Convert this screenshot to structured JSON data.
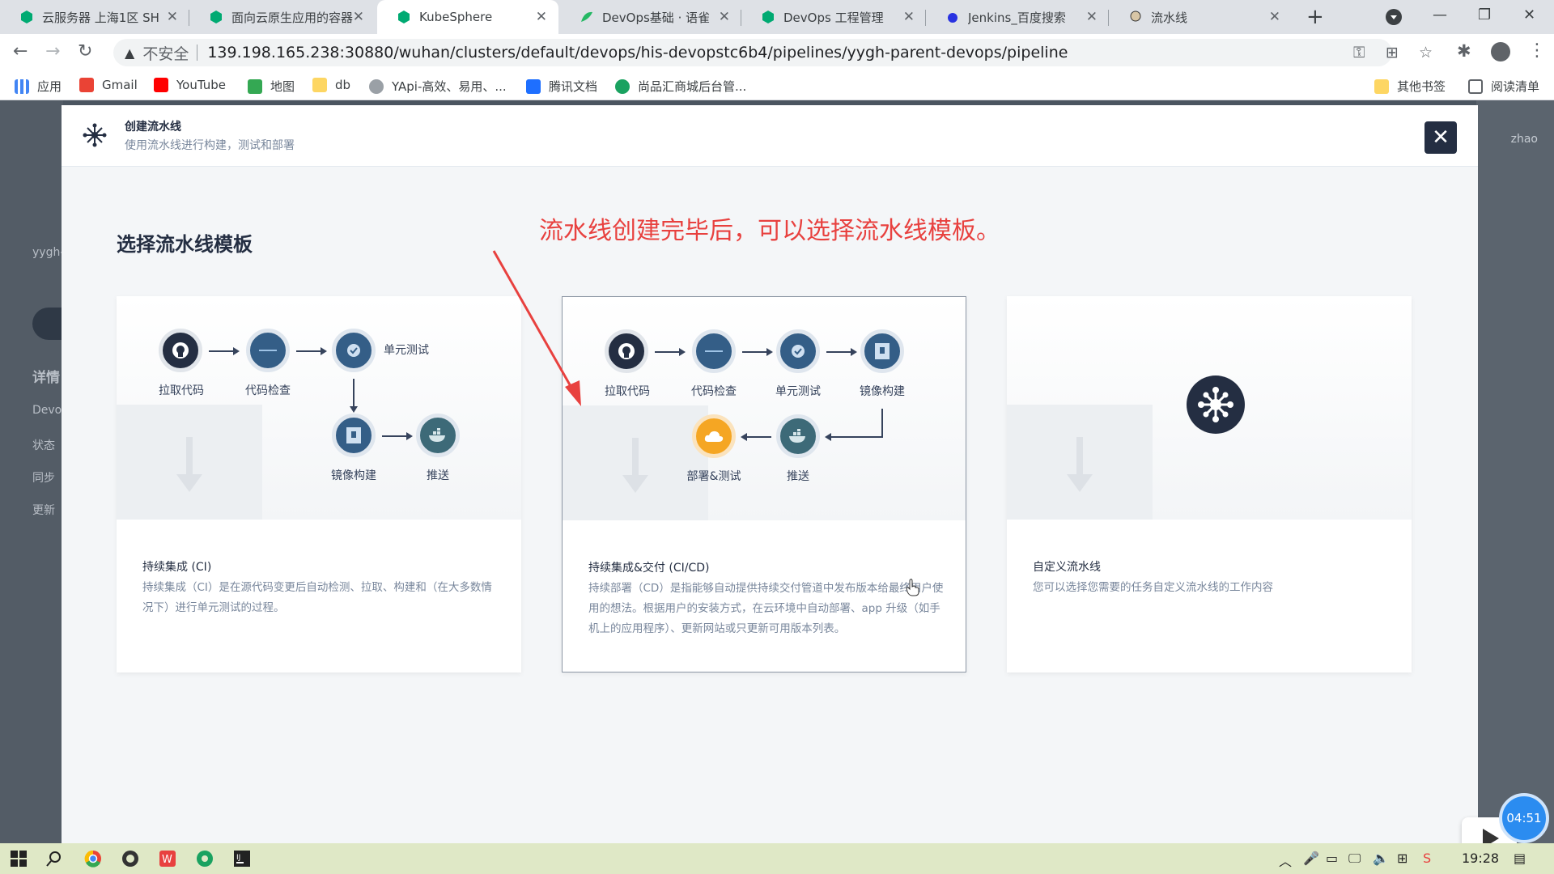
{
  "browser": {
    "tabs": [
      {
        "title": "云服务器 上海1区 SH",
        "active": false
      },
      {
        "title": "面向云原生应用的容器",
        "active": false
      },
      {
        "title": "KubeSphere",
        "active": true
      },
      {
        "title": "DevOps基础 · 语雀",
        "active": false
      },
      {
        "title": "DevOps 工程管理",
        "active": false
      },
      {
        "title": "Jenkins_百度搜索",
        "active": false
      },
      {
        "title": "流水线",
        "active": false
      }
    ],
    "insecure_label": "不安全",
    "url": "139.198.165.238:30880/wuhan/clusters/default/devops/his-devopstc6b4/pipelines/yygh-parent-devops/pipeline",
    "bookmarks": [
      "应用",
      "Gmail",
      "YouTube",
      "地图",
      "db",
      "YApi-高效、易用、...",
      "腾讯文档",
      "尚品汇商城后台管...",
      "其他书签",
      "阅读清单"
    ]
  },
  "background": {
    "user_text": "zhao",
    "left_items": [
      "yygh-",
      "详情",
      "Devo",
      "状态",
      "同步",
      "更新"
    ]
  },
  "modal": {
    "title": "创建流水线",
    "subtitle": "使用流水线进行构建，测试和部署",
    "section_title": "选择流水线模板",
    "annotation": "流水线创建完毕后，可以选择流水线模板。",
    "cards": [
      {
        "title": "持续集成 (CI)",
        "description": "持续集成（CI）是在源代码变更后自动检测、拉取、构建和（在大多数情况下）进行单元测试的过程。",
        "steps": [
          "拉取代码",
          "代码检查",
          "单元测试",
          "镜像构建",
          "推送"
        ]
      },
      {
        "title": "持续集成&交付 (CI/CD)",
        "description": "持续部署（CD）是指能够自动提供持续交付管道中发布版本给最终用户使用的想法。根据用户的安装方式，在云环境中自动部署、app 升级（如手机上的应用程序）、更新网站或只更新可用版本列表。",
        "steps": [
          "拉取代码",
          "代码检查",
          "单元测试",
          "镜像构建",
          "推送",
          "部署&测试"
        ],
        "selected": true
      },
      {
        "title": "自定义流水线",
        "description": "您可以选择您需要的任务自定义流水线的工作内容"
      }
    ]
  },
  "overlay": {
    "timer": "04:51"
  },
  "taskbar": {
    "time": "19:28"
  },
  "colors": {
    "annotation": "#e8413f",
    "dark_node": "#242e42",
    "blue_node": "#345e87",
    "orange_node": "#f5a623"
  }
}
